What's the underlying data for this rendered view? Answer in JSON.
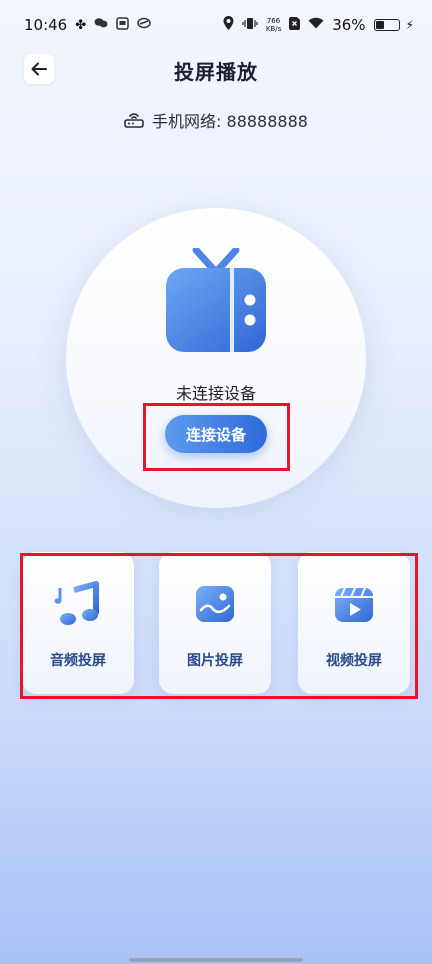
{
  "status_bar": {
    "time": "10:46",
    "net_speed_value": "766",
    "net_speed_unit": "KB/s",
    "battery": "36%",
    "battery_level": 0.36
  },
  "header": {
    "title": "投屏播放",
    "back_icon": "arrow-left-icon"
  },
  "network": {
    "label": "手机网络: 88888888",
    "icon": "router-icon"
  },
  "device_panel": {
    "status": "未连接设备",
    "connect_button": "连接设备",
    "icon": "tv-icon"
  },
  "cast_options": [
    {
      "label": "音频投屏",
      "icon": "music-note-icon"
    },
    {
      "label": "图片投屏",
      "icon": "image-icon"
    },
    {
      "label": "视频投屏",
      "icon": "video-clapper-icon"
    }
  ],
  "colors": {
    "accent": "#2e6ad9",
    "accent_light": "#5d9bf0",
    "highlight_red": "#e4162a",
    "card_label": "#2a4a8c"
  }
}
